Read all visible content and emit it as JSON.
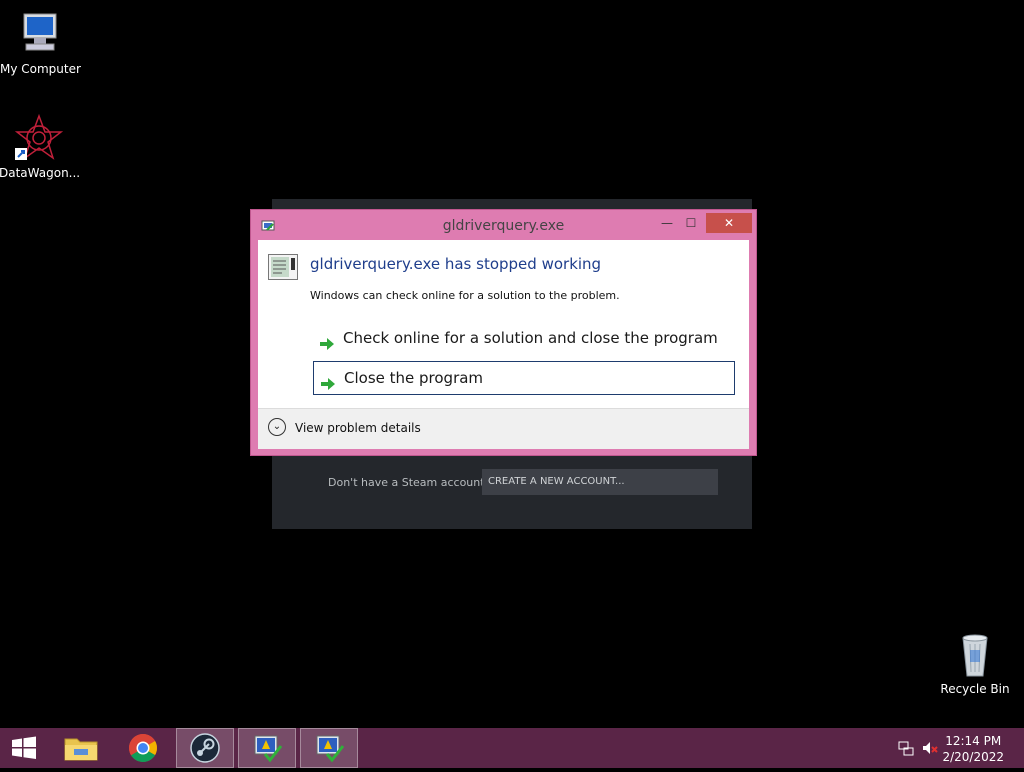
{
  "desktop": {
    "icons": [
      {
        "label": "My Computer"
      },
      {
        "label": "DataWagon..."
      },
      {
        "label": "Recycle Bin"
      }
    ]
  },
  "steam": {
    "question": "Don't have a Steam account?",
    "create_button": "CREATE A NEW ACCOUNT..."
  },
  "dialog": {
    "title": "gldriverquery.exe",
    "heading": "gldriverquery.exe has stopped working",
    "subtext": "Windows can check online for a solution to the problem.",
    "options": [
      {
        "label": "Check online for a solution and close the program"
      },
      {
        "label": "Close the program"
      }
    ],
    "details_label": "View problem details",
    "controls": {
      "minimize": "—",
      "maximize": "☐",
      "close": "✕"
    }
  },
  "taskbar": {
    "time": "12:14 PM",
    "date": "2/20/2022",
    "apps": [
      "file-explorer",
      "chrome",
      "steam",
      "error-report",
      "error-report"
    ]
  },
  "colors": {
    "dialog_frame": "#de7cb1",
    "taskbar": "#5a2547",
    "heading_blue": "#1f3e8c",
    "close_red": "#c7504b"
  }
}
